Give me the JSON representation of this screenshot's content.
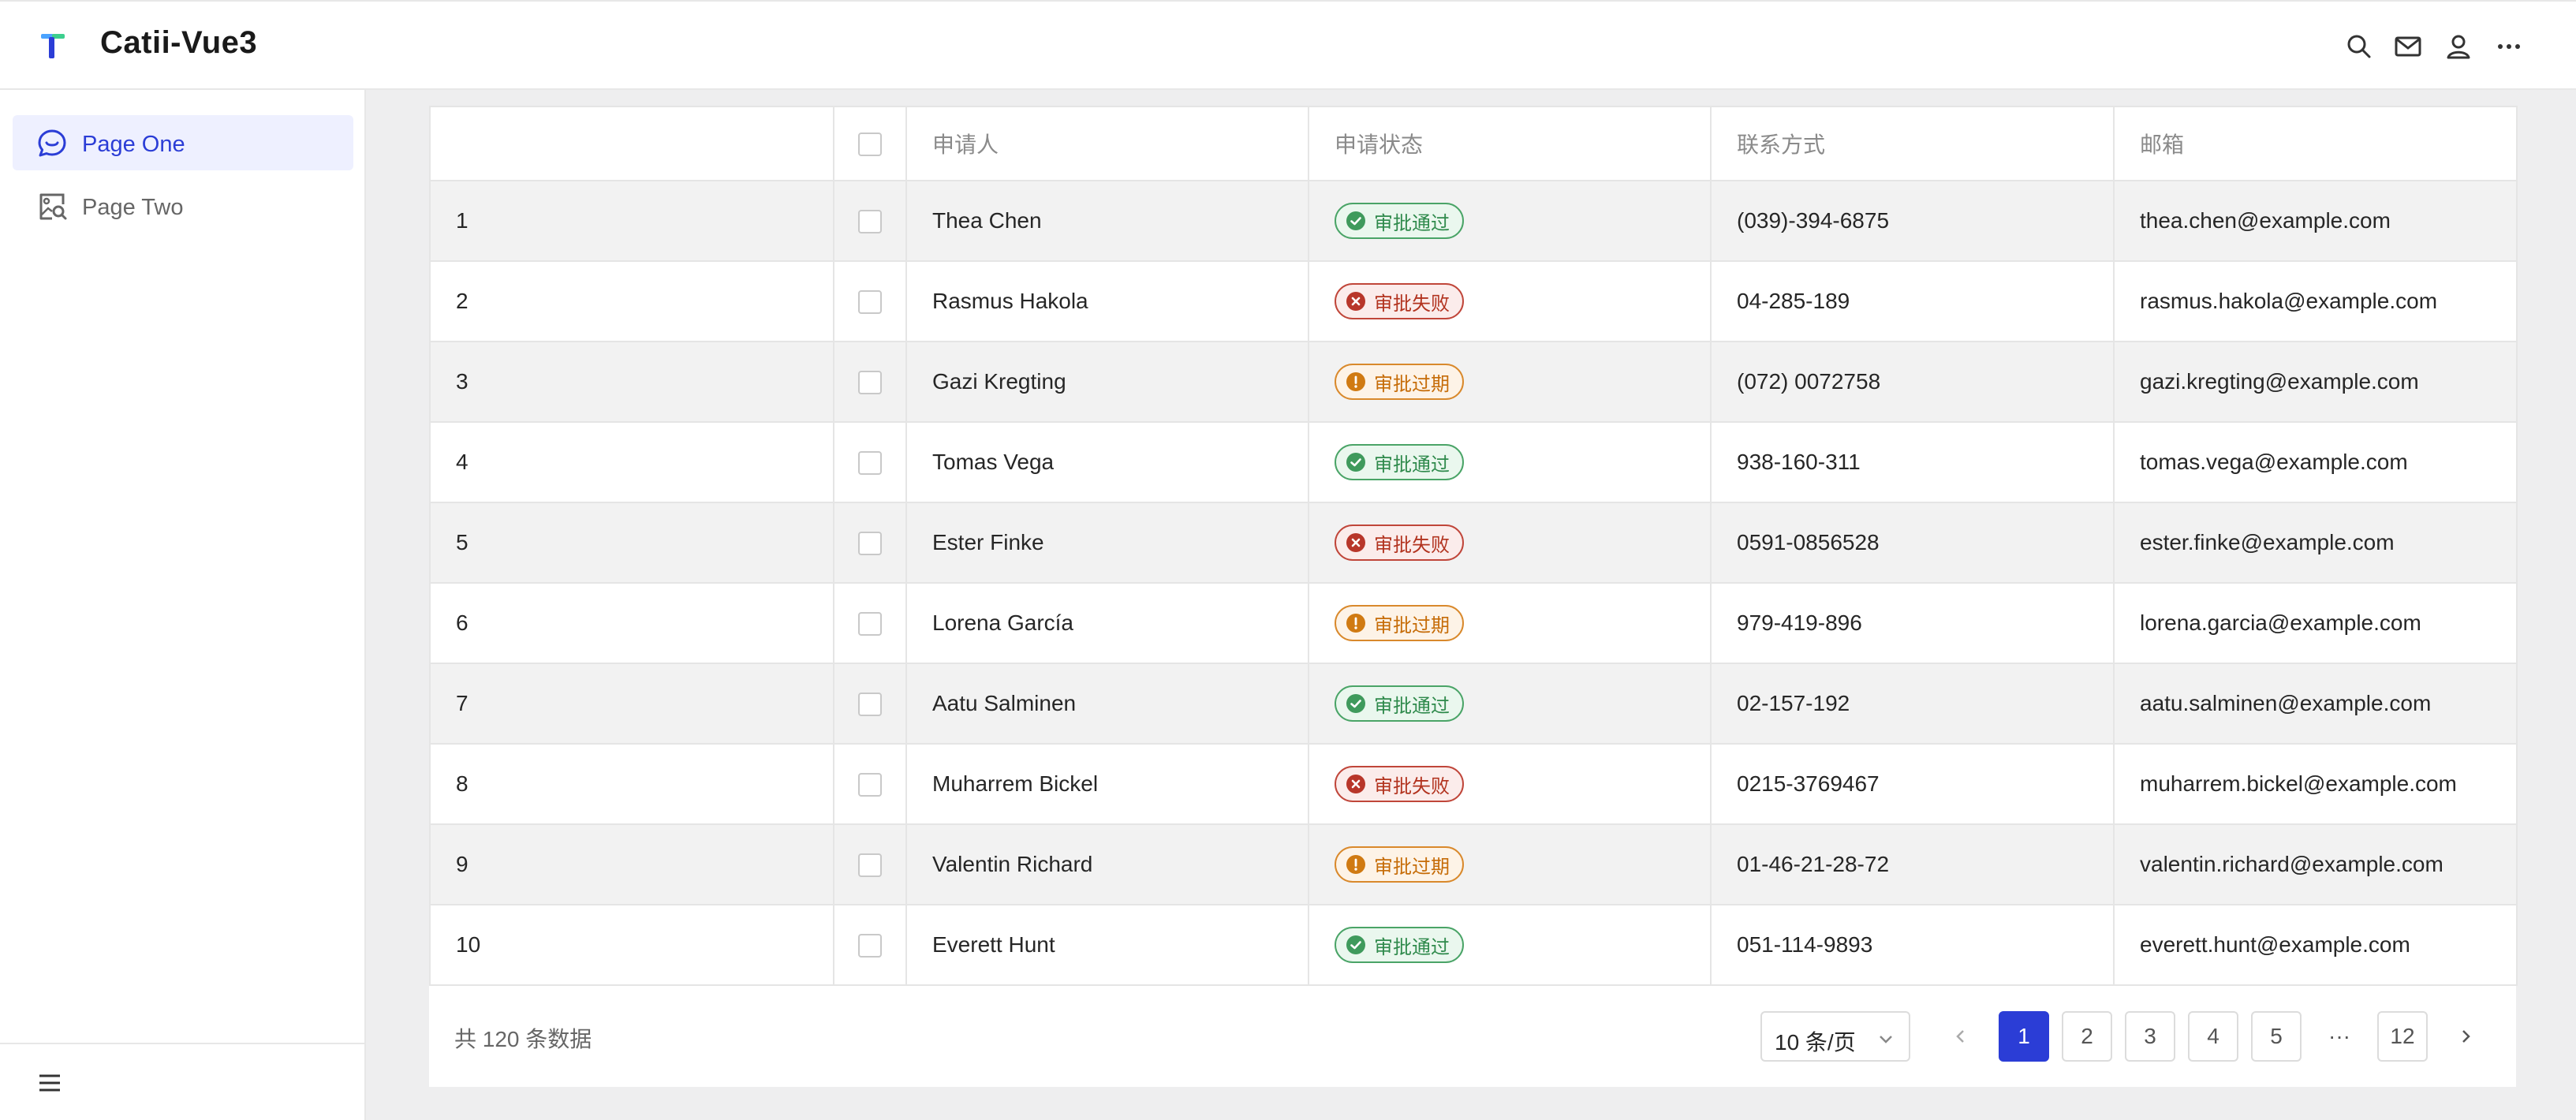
{
  "header": {
    "title": "Catii-Vue3",
    "icons": [
      "search-icon",
      "mail-icon",
      "user-icon",
      "more-icon"
    ]
  },
  "sidebar": {
    "items": [
      {
        "label": "Page One",
        "icon": "chat-icon",
        "active": true
      },
      {
        "label": "Page Two",
        "icon": "image-search-icon",
        "active": false
      }
    ]
  },
  "table": {
    "columns": [
      "",
      "",
      "申请人",
      "申请状态",
      "联系方式",
      "邮箱"
    ],
    "rows": [
      {
        "no": "1",
        "name": "Thea Chen",
        "status": "审批通过",
        "type": "ok",
        "phone": "(039)-394-6875",
        "email": "thea.chen@example.com"
      },
      {
        "no": "2",
        "name": "Rasmus Hakola",
        "status": "审批失败",
        "type": "fail",
        "phone": "04-285-189",
        "email": "rasmus.hakola@example.com"
      },
      {
        "no": "3",
        "name": "Gazi Kregting",
        "status": "审批过期",
        "type": "exp",
        "phone": "(072) 0072758",
        "email": "gazi.kregting@example.com"
      },
      {
        "no": "4",
        "name": "Tomas Vega",
        "status": "审批通过",
        "type": "ok",
        "phone": "938-160-311",
        "email": "tomas.vega@example.com"
      },
      {
        "no": "5",
        "name": "Ester Finke",
        "status": "审批失败",
        "type": "fail",
        "phone": "0591-0856528",
        "email": "ester.finke@example.com"
      },
      {
        "no": "6",
        "name": "Lorena García",
        "status": "审批过期",
        "type": "exp",
        "phone": "979-419-896",
        "email": "lorena.garcia@example.com"
      },
      {
        "no": "7",
        "name": "Aatu Salminen",
        "status": "审批通过",
        "type": "ok",
        "phone": "02-157-192",
        "email": "aatu.salminen@example.com"
      },
      {
        "no": "8",
        "name": "Muharrem Bickel",
        "status": "审批失败",
        "type": "fail",
        "phone": "0215-3769467",
        "email": "muharrem.bickel@example.com"
      },
      {
        "no": "9",
        "name": "Valentin Richard",
        "status": "审批过期",
        "type": "exp",
        "phone": "01-46-21-28-72",
        "email": "valentin.richard@example.com"
      },
      {
        "no": "10",
        "name": "Everett Hunt",
        "status": "审批通过",
        "type": "ok",
        "phone": "051-114-9893",
        "email": "everett.hunt@example.com"
      }
    ]
  },
  "pagination": {
    "total_text": "共 120 条数据",
    "page_size": "10 条/页",
    "pages": [
      "1",
      "2",
      "3",
      "4",
      "5",
      "···",
      "12"
    ],
    "current": "1"
  },
  "colors": {
    "accent": "#2b3dd6",
    "success": "#2f8a4c",
    "error": "#b2331f",
    "warning": "#c66c08"
  }
}
